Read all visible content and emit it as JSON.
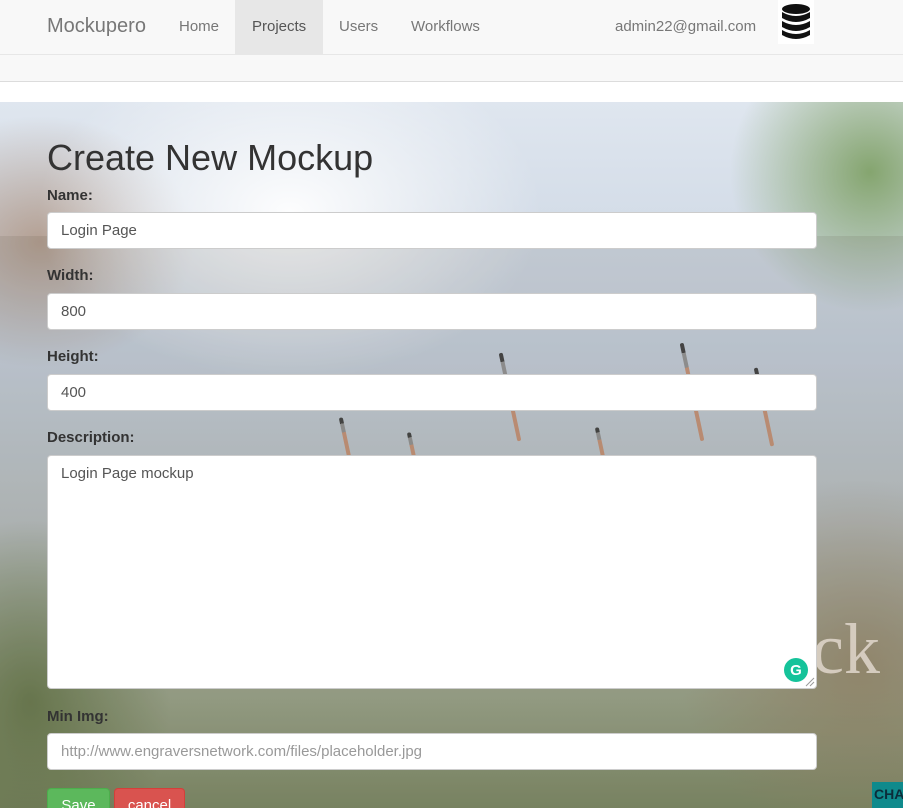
{
  "navbar": {
    "brand": "Mockupero",
    "items": [
      {
        "label": "Home",
        "active": false
      },
      {
        "label": "Projects",
        "active": true
      },
      {
        "label": "Users",
        "active": false
      },
      {
        "label": "Workflows",
        "active": false
      }
    ],
    "user_email": "admin22@gmail.com",
    "user_icon": "database-icon"
  },
  "form": {
    "title": "Create New Mockup",
    "name": {
      "label": "Name:",
      "value": "Login Page"
    },
    "width": {
      "label": "Width:",
      "value": "800"
    },
    "height": {
      "label": "Height:",
      "value": "400"
    },
    "description": {
      "label": "Description:",
      "value": "Login Page mockup"
    },
    "min_img": {
      "label": "Min Img:",
      "placeholder": "http://www.engraversnetwork.com/files/placeholder.jpg"
    },
    "save_label": "Save",
    "cancel_label": "cancel"
  },
  "grammarly_badge": "G",
  "chat_widget": "CHA",
  "background_watermark": "ck",
  "colors": {
    "save": "#5cb85c",
    "cancel": "#d9534f",
    "navbar_bg": "#f8f8f8",
    "active_tab": "#e7e7e7",
    "grammarly": "#15c39a",
    "chat": "#0f8a8c"
  }
}
